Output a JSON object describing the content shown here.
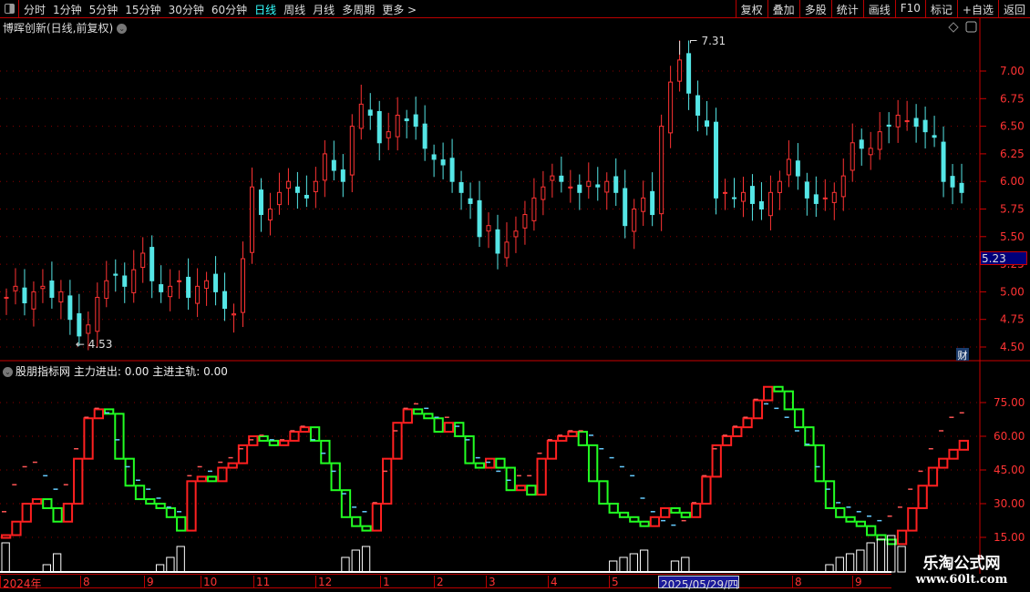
{
  "toolbar": {
    "periods": [
      "分时",
      "1分钟",
      "5分钟",
      "15分钟",
      "30分钟",
      "60分钟",
      "日线",
      "周线",
      "月线",
      "多周期",
      "更多 >"
    ],
    "active_period": "日线",
    "right_buttons": [
      "复权",
      "叠加",
      "多股",
      "统计",
      "画线",
      "F10",
      "标记",
      "+自选",
      "返回"
    ]
  },
  "stock_title": "博晖创新(日线,前复权)",
  "price_axis": {
    "ticks": [
      "7.00",
      "6.75",
      "6.50",
      "6.25",
      "6.00",
      "5.75",
      "5.50",
      "5.25",
      "5.00",
      "4.75",
      "4.50"
    ],
    "current_price": "5.23",
    "cai_badge": "财"
  },
  "annotations": {
    "high": "7.31",
    "low": "4.53"
  },
  "indicator": {
    "name": "股朋指标网",
    "line1_label": "主力进出:",
    "line1_value": "0.00",
    "line2_label": "主进主轨:",
    "line2_value": "0.00",
    "ticks": [
      "75.00",
      "60.00",
      "45.00",
      "30.00",
      "15.00"
    ]
  },
  "date_axis": [
    "2024年",
    "8",
    "9",
    "10",
    "11",
    "12",
    "1",
    "2",
    "3",
    "4",
    "5",
    "2025/05/29/四",
    "8",
    "9"
  ],
  "watermark": {
    "line1": "乐淘公式网",
    "line2": "www.60lt.com"
  },
  "colors": {
    "up": "#ff3333",
    "down": "#55e6e6",
    "main_up": "#ff2020",
    "main_down": "#22ff22",
    "axis": "#cc0000"
  },
  "chart_data": {
    "type": "candlestick",
    "ylim": [
      4.45,
      7.35
    ],
    "closes": [
      4.95,
      5.05,
      4.9,
      5.0,
      5.05,
      4.95,
      5.0,
      4.75,
      4.6,
      4.7,
      4.95,
      5.1,
      5.15,
      5.05,
      5.2,
      5.35,
      5.1,
      5.0,
      5.05,
      5.1,
      4.95,
      5.05,
      5.1,
      5.0,
      4.85,
      4.8,
      5.3,
      5.95,
      5.7,
      5.75,
      5.9,
      6.0,
      5.9,
      5.85,
      6.0,
      6.25,
      6.1,
      6.0,
      6.5,
      6.7,
      6.6,
      6.35,
      6.45,
      6.6,
      6.55,
      6.5,
      6.3,
      6.2,
      6.15,
      6.0,
      5.9,
      5.8,
      5.5,
      5.6,
      5.35,
      5.45,
      5.55,
      5.7,
      5.85,
      5.95,
      6.05,
      6.0,
      5.95,
      5.9,
      6.0,
      5.95,
      6.0,
      5.9,
      5.6,
      5.75,
      5.85,
      5.7,
      6.5,
      6.9,
      7.1,
      6.8,
      6.6,
      6.5,
      5.85,
      5.9,
      5.85,
      5.9,
      5.8,
      5.75,
      5.9,
      6.0,
      6.2,
      6.05,
      5.85,
      5.8,
      5.85,
      5.9,
      6.05,
      6.35,
      6.3,
      6.3,
      6.45,
      6.5,
      6.6,
      6.55,
      6.5,
      6.45,
      6.4,
      6.0,
      5.95,
      5.9
    ],
    "indicator_main": [
      16,
      22,
      30,
      32,
      28,
      22,
      30,
      50,
      68,
      72,
      70,
      50,
      38,
      32,
      30,
      28,
      24,
      18,
      40,
      42,
      40,
      46,
      48,
      56,
      60,
      58,
      56,
      58,
      62,
      64,
      58,
      48,
      36,
      24,
      20,
      18,
      30,
      50,
      66,
      72,
      70,
      68,
      62,
      66,
      60,
      48,
      46,
      50,
      46,
      36,
      38,
      34,
      50,
      58,
      60,
      62,
      56,
      40,
      30,
      26,
      24,
      22,
      20,
      24,
      28,
      26,
      24,
      30,
      42,
      56,
      60,
      64,
      68,
      76,
      82,
      80,
      72,
      64,
      56,
      40,
      28,
      24,
      22,
      20,
      16,
      14,
      12,
      18,
      28,
      38,
      46,
      50,
      54,
      58
    ],
    "indicator_track": [
      24,
      36,
      44,
      46,
      40,
      34,
      36,
      52,
      66,
      70,
      68,
      56,
      44,
      38,
      34,
      30,
      26,
      24,
      40,
      44,
      42,
      46,
      48,
      52,
      56,
      58,
      56,
      56,
      60,
      62,
      56,
      50,
      42,
      32,
      26,
      24,
      28,
      42,
      60,
      70,
      72,
      70,
      66,
      66,
      62,
      56,
      48,
      46,
      42,
      38,
      40,
      40,
      50,
      56,
      58,
      60,
      60,
      58,
      52,
      48,
      44,
      40,
      30,
      24,
      20,
      18,
      20,
      28,
      40,
      52,
      58,
      62,
      66,
      74,
      72,
      70,
      66,
      60,
      54,
      44,
      34,
      28,
      26,
      24,
      22,
      20,
      22,
      26,
      34,
      42,
      52,
      60,
      66,
      68
    ]
  }
}
